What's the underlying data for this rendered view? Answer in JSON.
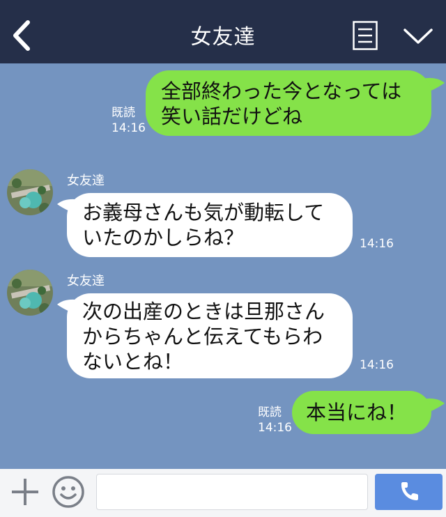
{
  "header": {
    "title": "女友達",
    "back_icon": "chevron-left-icon",
    "menu_icon": "list-icon",
    "collapse_icon": "chevron-down-icon"
  },
  "messages": [
    {
      "side": "me",
      "lines": [
        "全部終わった今となっては",
        "笑い話だけどね"
      ],
      "read_label": "既読",
      "time": "14:16"
    },
    {
      "side": "them",
      "sender": "女友達",
      "lines": [
        "お義母さんも気が動転して",
        "いたのかしらね？"
      ],
      "time": "14:16"
    },
    {
      "side": "them",
      "sender": "女友達",
      "lines": [
        "次の出産のときは旦那さん",
        "からちゃんと伝えてもらわ",
        "ないとね！"
      ],
      "time": "14:16"
    },
    {
      "side": "me",
      "lines": [
        "本当にね！"
      ],
      "read_label": "既読",
      "time": "14:16"
    }
  ],
  "footer": {
    "input_placeholder": "",
    "plus_icon": "plus-icon",
    "sticker_icon": "smiley-icon",
    "call_icon": "phone-icon"
  },
  "colors": {
    "header_bg": "#252f49",
    "chat_bg": "#7494c0",
    "my_bubble": "#85e249",
    "their_bubble": "#ffffff",
    "call_button": "#5a8ce0"
  }
}
